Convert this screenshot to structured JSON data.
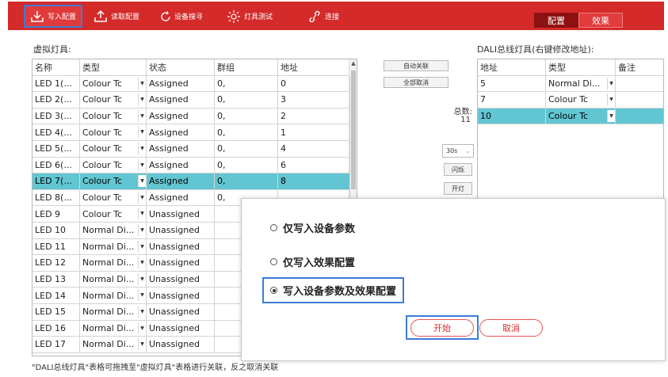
{
  "toolbar": {
    "buttons": [
      {
        "label": "写入配置",
        "icon": "download-icon"
      },
      {
        "label": "读取配置",
        "icon": "upload-icon"
      },
      {
        "label": "设备搜寻",
        "icon": "refresh-icon"
      },
      {
        "label": "灯具测试",
        "icon": "light-burst-icon"
      },
      {
        "label": "连接",
        "icon": "link-icon"
      }
    ],
    "tabs": [
      {
        "label": "配置",
        "active": true
      },
      {
        "label": "效果",
        "active": false
      }
    ],
    "accent_color": "#d42a2a"
  },
  "virtual": {
    "title": "虚拟灯具:",
    "columns": [
      "名称",
      "类型",
      "状态",
      "群组",
      "地址"
    ],
    "rows": [
      [
        "LED 1(...",
        "Colour Tc",
        "Assigned",
        "0,",
        "0"
      ],
      [
        "LED 2(...",
        "Colour Tc",
        "Assigned",
        "0,",
        "3"
      ],
      [
        "LED 3(...",
        "Colour Tc",
        "Assigned",
        "0,",
        "2"
      ],
      [
        "LED 4(...",
        "Colour Tc",
        "Assigned",
        "0,",
        "1"
      ],
      [
        "LED 5(...",
        "Colour Tc",
        "Assigned",
        "0,",
        "4"
      ],
      [
        "LED 6(...",
        "Colour Tc",
        "Assigned",
        "0,",
        "6"
      ],
      [
        "LED 7(...",
        "Colour Tc",
        "Assigned",
        "0,",
        "8"
      ],
      [
        "LED 8(...",
        "Colour Tc",
        "Assigned",
        "0,",
        ""
      ],
      [
        "LED 9",
        "Colour Tc",
        "Unassigned",
        "",
        ""
      ],
      [
        "LED 10",
        "Normal Di...",
        "Unassigned",
        "",
        ""
      ],
      [
        "LED 11",
        "Normal Di...",
        "Unassigned",
        "",
        ""
      ],
      [
        "LED 12",
        "Normal Di...",
        "Unassigned",
        "",
        ""
      ],
      [
        "LED 13",
        "Normal Di...",
        "Unassigned",
        "",
        ""
      ],
      [
        "LED 14",
        "Normal Di...",
        "Unassigned",
        "",
        ""
      ],
      [
        "LED 15",
        "Normal Di...",
        "Unassigned",
        "",
        ""
      ],
      [
        "LED 16",
        "Normal Di...",
        "Unassigned",
        "",
        ""
      ],
      [
        "LED 17",
        "Normal Di...",
        "Unassigned",
        "",
        ""
      ]
    ],
    "selected_row": 6,
    "selection_color": "#62c6d2"
  },
  "middle": {
    "auto_link": "自动关联",
    "unlink_all": "全部取消",
    "total_label": "总数:",
    "total_value": "11",
    "interval_value": "30s",
    "flash": "闪烁",
    "lamp_on": "开灯"
  },
  "dali": {
    "title": "DALI总线灯具(右键修改地址):",
    "columns": [
      "地址",
      "类型",
      "备注"
    ],
    "rows": [
      [
        "5",
        "Normal Di...",
        ""
      ],
      [
        "7",
        "Colour Tc",
        ""
      ],
      [
        "10",
        "Colour Tc",
        ""
      ]
    ],
    "selected_row": 2
  },
  "note": "\"DALI总线灯具\"表格可拖拽至\"虚拟灯具\"表格进行关联，反之取消关联",
  "dialog": {
    "options": [
      {
        "label": "仅写入设备参数",
        "checked": false
      },
      {
        "label": "仅写入效果配置",
        "checked": false
      },
      {
        "label": "写入设备参数及效果配置",
        "checked": true
      }
    ],
    "start": "开始",
    "cancel": "取消"
  }
}
